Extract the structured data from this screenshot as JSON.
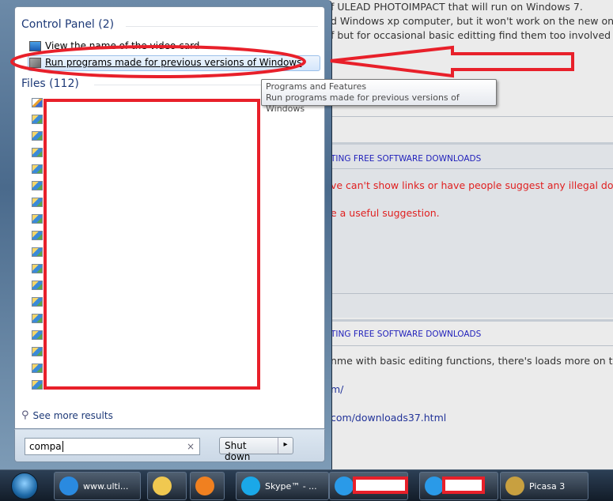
{
  "page": {
    "lines": [
      "f ULEAD PHOTOIMPACT that will run on Windows 7.",
      "d Windows xp computer, but it won't work on the new one.",
      "f but for occasional basic editting find them too involved"
    ],
    "section1_header": "TING FREE SOFTWARE DOWNLOADS",
    "section1_red1": "ve can't show links or have people suggest any illegal downloa",
    "section1_red2": "e a useful suggestion.",
    "section2_header": "TING FREE SOFTWARE DOWNLOADS",
    "section2_text": "nme with basic editing functions, there's loads more on the m",
    "section2_link1": "m/",
    "section2_link2": "com/downloads37.html"
  },
  "start_menu": {
    "control_panel": {
      "label": "Control Panel (2)",
      "items": [
        {
          "label": "View the name of the video card",
          "icon": "monitor-icon"
        },
        {
          "label": "Run programs made for previous versions of Windows",
          "icon": "compatibility-icon",
          "selected": true
        }
      ]
    },
    "files": {
      "label": "Files (112)",
      "icon": "image-file-icon"
    },
    "see_more": "See more results",
    "search": {
      "value": "compa",
      "clear": "×"
    },
    "shutdown": {
      "label": "Shut down",
      "arrow": "▸"
    }
  },
  "tooltip": {
    "title": "Programs and Features",
    "desc": "Run programs made for previous versions of Windows"
  },
  "taskbar": {
    "items": [
      {
        "label": "www.ulti...",
        "icon": "internet-explorer-icon"
      },
      {
        "label": "",
        "icon": "explorer-folder-icon"
      },
      {
        "label": "",
        "icon": "media-player-icon"
      },
      {
        "label": "Skype™ - ...",
        "icon": "skype-icon"
      },
      {
        "label": "",
        "icon": "chat-icon"
      },
      {
        "label": "",
        "icon": "chat-icon"
      },
      {
        "label": "Picasa 3",
        "icon": "picasa-icon"
      }
    ]
  },
  "annotation_color": "#e8202a"
}
